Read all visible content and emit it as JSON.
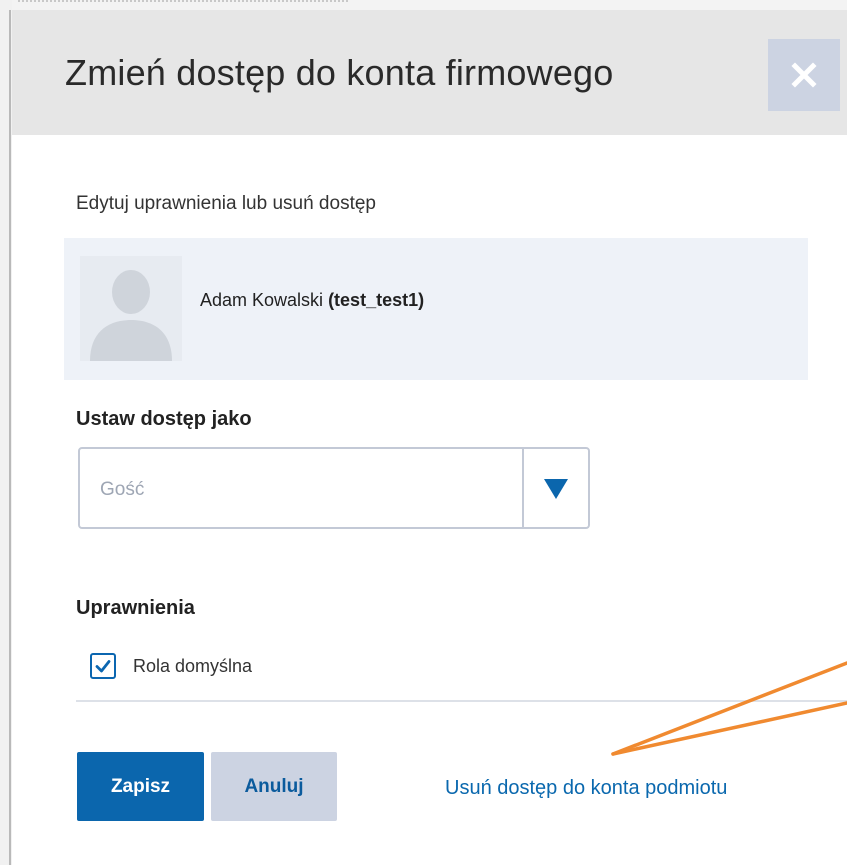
{
  "modal": {
    "title": "Zmień dostęp do konta firmowego",
    "close_icon": "close-icon",
    "subtitle": "Edytuj uprawnienia lub usuń dostęp"
  },
  "user": {
    "name": "Adam Kowalski",
    "login": "(test_test1)",
    "avatar_icon": "user-placeholder-icon"
  },
  "role": {
    "label": "Ustaw dostęp jako",
    "selected": "Gość",
    "dropdown_icon": "triangle-down-icon"
  },
  "permissions": {
    "label": "Uprawnienia",
    "items": [
      {
        "label": "Rola domyślna",
        "checked": true
      }
    ]
  },
  "actions": {
    "save_label": "Zapisz",
    "cancel_label": "Anuluj",
    "remove_label": "Usuń dostęp do konta podmiotu"
  },
  "colors": {
    "primary": "#0b66ad",
    "secondary_button": "#ccd3e2",
    "header_bg": "#e6e6e6",
    "card_bg": "#eef2f8",
    "annotation_arrow": "#f08a30"
  }
}
